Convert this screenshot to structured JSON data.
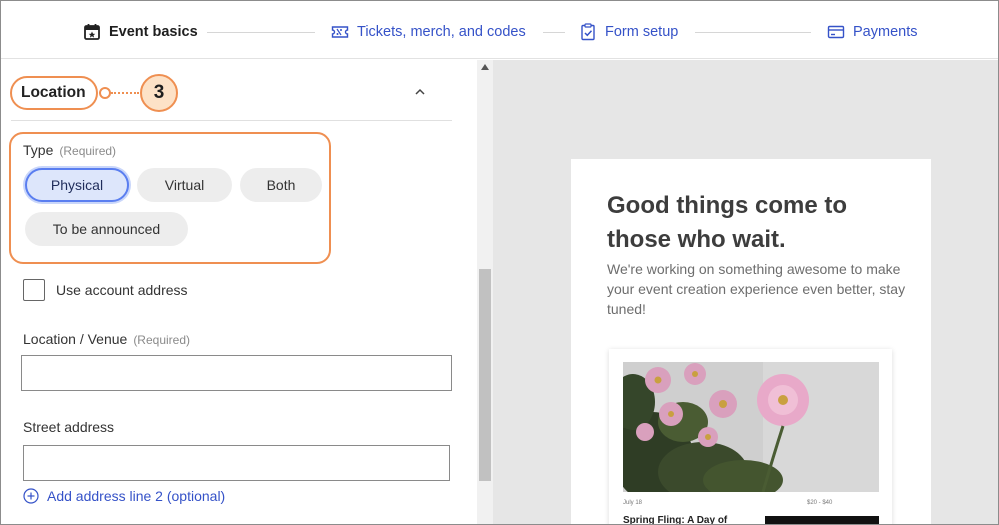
{
  "stepper": {
    "steps": [
      {
        "label": "Event basics",
        "icon": "calendar-star-icon",
        "state": "active"
      },
      {
        "label": "Tickets, merch, and codes",
        "icon": "ticket-icon",
        "state": "link"
      },
      {
        "label": "Form setup",
        "icon": "clipboard-check-icon",
        "state": "link"
      },
      {
        "label": "Payments",
        "icon": "credit-card-icon",
        "state": "link"
      }
    ]
  },
  "location": {
    "title": "Location",
    "callout_number": "3",
    "type_label": "Type",
    "required_text": "(Required)",
    "type_options": [
      "Physical",
      "Virtual",
      "Both",
      "To be announced"
    ],
    "selected_type": "Physical",
    "use_account_address": "Use account address",
    "use_account_address_checked": false,
    "venue_label": "Location / Venue",
    "venue_required": "(Required)",
    "venue_value": "",
    "street_label": "Street address",
    "street_value": "",
    "add_line_label": "Add address line 2 (optional)"
  },
  "preview": {
    "headline": "Good things come to those who wait.",
    "subtext": "We're working on something awesome to make your event creation experience even better, stay tuned!",
    "event_date": "July 18",
    "event_price": "$20 - $40",
    "event_title": "Spring Fling: A Day of"
  },
  "colors": {
    "accent_blue": "#3552c8",
    "callout_orange": "#ef8f51",
    "selected_pill_bg": "#dde6fb",
    "preview_bg": "#e6e6e6"
  }
}
